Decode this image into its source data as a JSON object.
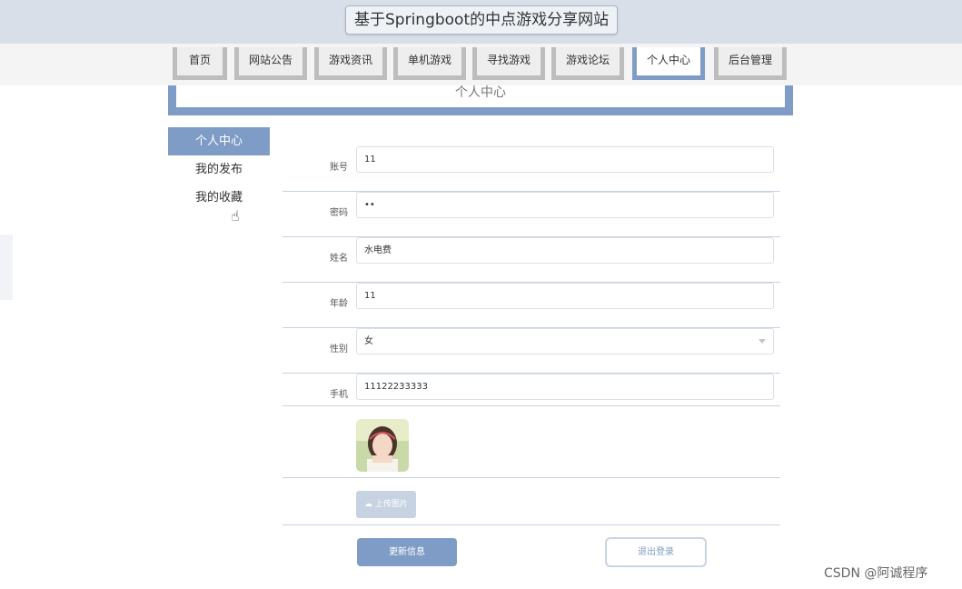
{
  "header": {
    "title": "基于Springboot的中点游戏分享网站"
  },
  "nav": {
    "items": [
      {
        "label": "首页",
        "active": false
      },
      {
        "label": "网站公告",
        "active": false
      },
      {
        "label": "游戏资讯",
        "active": false
      },
      {
        "label": "单机游戏",
        "active": false
      },
      {
        "label": "寻找游戏",
        "active": false
      },
      {
        "label": "游戏论坛",
        "active": false
      },
      {
        "label": "个人中心",
        "active": true
      },
      {
        "label": "后台管理",
        "active": false
      }
    ]
  },
  "banner": {
    "title": "个人中心"
  },
  "sidebar": {
    "items": [
      {
        "label": "个人中心",
        "active": true
      },
      {
        "label": "我的发布",
        "active": false
      },
      {
        "label": "我的收藏",
        "active": false
      }
    ]
  },
  "form": {
    "account": {
      "label": "账号",
      "value": "11"
    },
    "password": {
      "label": "密码",
      "value": "••"
    },
    "name": {
      "label": "姓名",
      "value": "水电费"
    },
    "age": {
      "label": "年龄",
      "value": "11"
    },
    "gender": {
      "label": "性别",
      "value": "女"
    },
    "phone": {
      "label": "手机",
      "value": "11122233333"
    },
    "upload_label": "上传图片"
  },
  "actions": {
    "update": "更新信息",
    "logout": "退出登录"
  },
  "watermark": "CSDN @阿诚程序",
  "colors": {
    "accent": "#7f9cc6",
    "header_bg": "#d8dfe8"
  }
}
